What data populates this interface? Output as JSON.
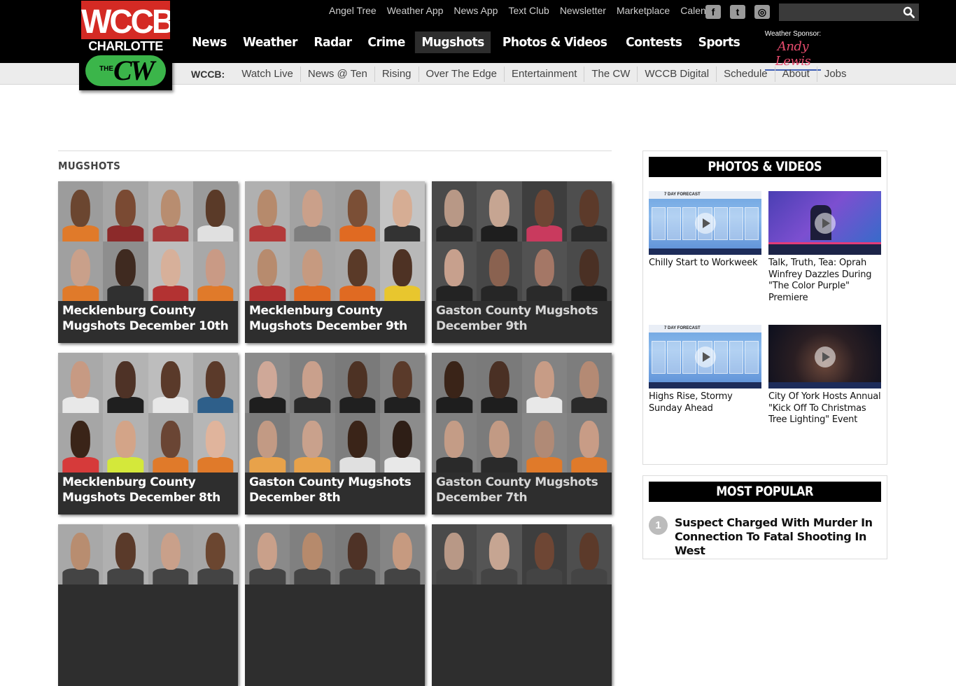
{
  "logo": {
    "top": "WCCB",
    "middle": "CHARLOTTE",
    "the": "THE",
    "cw": "CW"
  },
  "toplinks": [
    "Angel Tree",
    "Weather App",
    "News App",
    "Text Club",
    "Newsletter",
    "Marketplace",
    "Calendar"
  ],
  "social": {
    "facebook": "facebook-icon",
    "twitter": "twitter-icon",
    "instagram": "instagram-icon"
  },
  "search": {
    "placeholder": "",
    "icon": "search-icon"
  },
  "mainnav": [
    "News",
    "Weather",
    "Radar",
    "Crime",
    "Mugshots",
    "Photos & Videos",
    "Contests",
    "Sports"
  ],
  "mainnav_active": "Mugshots",
  "sponsor": {
    "label": "Weather Sponsor:",
    "name": "Andy Lewis"
  },
  "subnav": {
    "label": "WCCB:",
    "items": [
      "Watch Live",
      "News @ Ten",
      "Rising",
      "Over The Edge",
      "Entertainment",
      "The CW",
      "WCCB Digital",
      "Schedule",
      "About",
      "Jobs"
    ]
  },
  "section_title": "MUGSHOTS",
  "cards": [
    "Mecklenburg County Mugshots December 10th",
    "Mecklenburg County Mugshots December 9th",
    "Gaston County Mugshots December 9th",
    "Mecklenburg County Mugshots December 8th",
    "Gaston County Mugshots December 8th",
    "Gaston County Mugshots December 7th"
  ],
  "sidebar": {
    "photos_heading": "PHOTOS & VIDEOS",
    "videos": [
      {
        "title": "Chilly Start to Workweek",
        "thumb_text": "7 DAY FORECAST"
      },
      {
        "title": "Talk, Truth, Tea: Oprah Winfrey Dazzles During \"The Color Purple\" Premiere",
        "thumb_text": ""
      },
      {
        "title": "Highs Rise, Stormy Sunday Ahead",
        "thumb_text": "7 DAY FORECAST"
      },
      {
        "title": "City Of York Hosts Annual \"Kick Off To Christmas Tree Lighting\" Event",
        "thumb_text": ""
      }
    ],
    "popular_heading": "MOST POPULAR",
    "popular": [
      {
        "num": "1",
        "title": "Suspect Charged With Murder In Connection To Fatal Shooting In West"
      }
    ]
  },
  "colors": {
    "brand_red": "#d42a24",
    "brand_green": "#3bb54a",
    "nav_bg": "#000000",
    "subnav_bg": "#ececec"
  }
}
